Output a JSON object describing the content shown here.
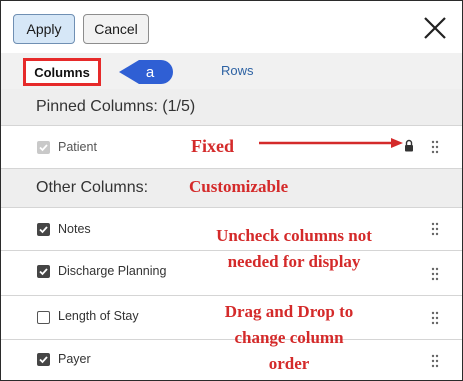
{
  "toolbar": {
    "apply_label": "Apply",
    "cancel_label": "Cancel"
  },
  "tabs": {
    "columns_label": "Columns",
    "rows_label": "Rows",
    "marker_label": "a"
  },
  "pinned": {
    "heading": "Pinned Columns: (1/5)",
    "items": [
      {
        "label": "Patient",
        "checked": true,
        "disabled": true,
        "locked": true
      }
    ]
  },
  "other": {
    "heading": "Other Columns:",
    "items": [
      {
        "label": "Notes",
        "checked": true
      },
      {
        "label": "Discharge Planning",
        "checked": true
      },
      {
        "label": "Length of Stay",
        "checked": false
      },
      {
        "label": "Payer",
        "checked": true
      }
    ]
  },
  "annotations": {
    "fixed": "Fixed",
    "customizable": "Customizable",
    "uncheck_line1": "Uncheck columns not",
    "uncheck_line2": "needed for display",
    "drag_line1": "Drag and Drop to",
    "drag_line2": "change column",
    "drag_line3": "order"
  },
  "colors": {
    "annotation_red": "#d42a2a",
    "tab_highlight": "#e62a2a",
    "marker_blue": "#2f5fd4",
    "apply_button_bg": "#d6e7f7"
  },
  "icons": [
    "close-icon",
    "lock-icon",
    "drag-handle-icon",
    "checkbox-checked-icon",
    "checkbox-unchecked-icon"
  ]
}
